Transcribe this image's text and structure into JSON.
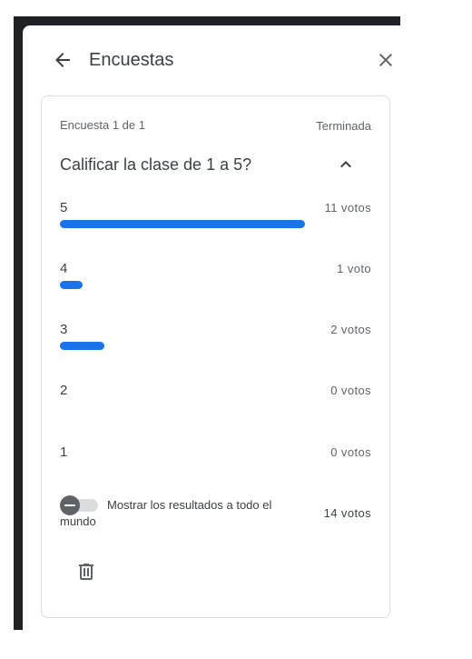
{
  "header": {
    "title": "Encuestas",
    "back_icon": "arrow-back-icon",
    "close_icon": "close-icon"
  },
  "poll": {
    "count_text": "Encuesta 1 de 1",
    "status": "Terminada",
    "question": "Calificar la clase de 1 a 5?",
    "collapse_icon": "chevron-up-icon",
    "options": [
      {
        "label": "5",
        "votes_text": "11 votos",
        "votes": 11
      },
      {
        "label": "4",
        "votes_text": "1 voto",
        "votes": 1
      },
      {
        "label": "3",
        "votes_text": "2 votos",
        "votes": 2
      },
      {
        "label": "2",
        "votes_text": "0 votos",
        "votes": 0
      },
      {
        "label": "1",
        "votes_text": "0 votos",
        "votes": 0
      }
    ],
    "show_results_label": "Mostrar los resultados a todo el mundo",
    "show_results_enabled": false,
    "total_votes_text": "14 votos",
    "delete_icon": "trash-icon"
  },
  "colors": {
    "accent": "#1a73e8",
    "text": "#3c4043",
    "muted": "#5f6368"
  }
}
